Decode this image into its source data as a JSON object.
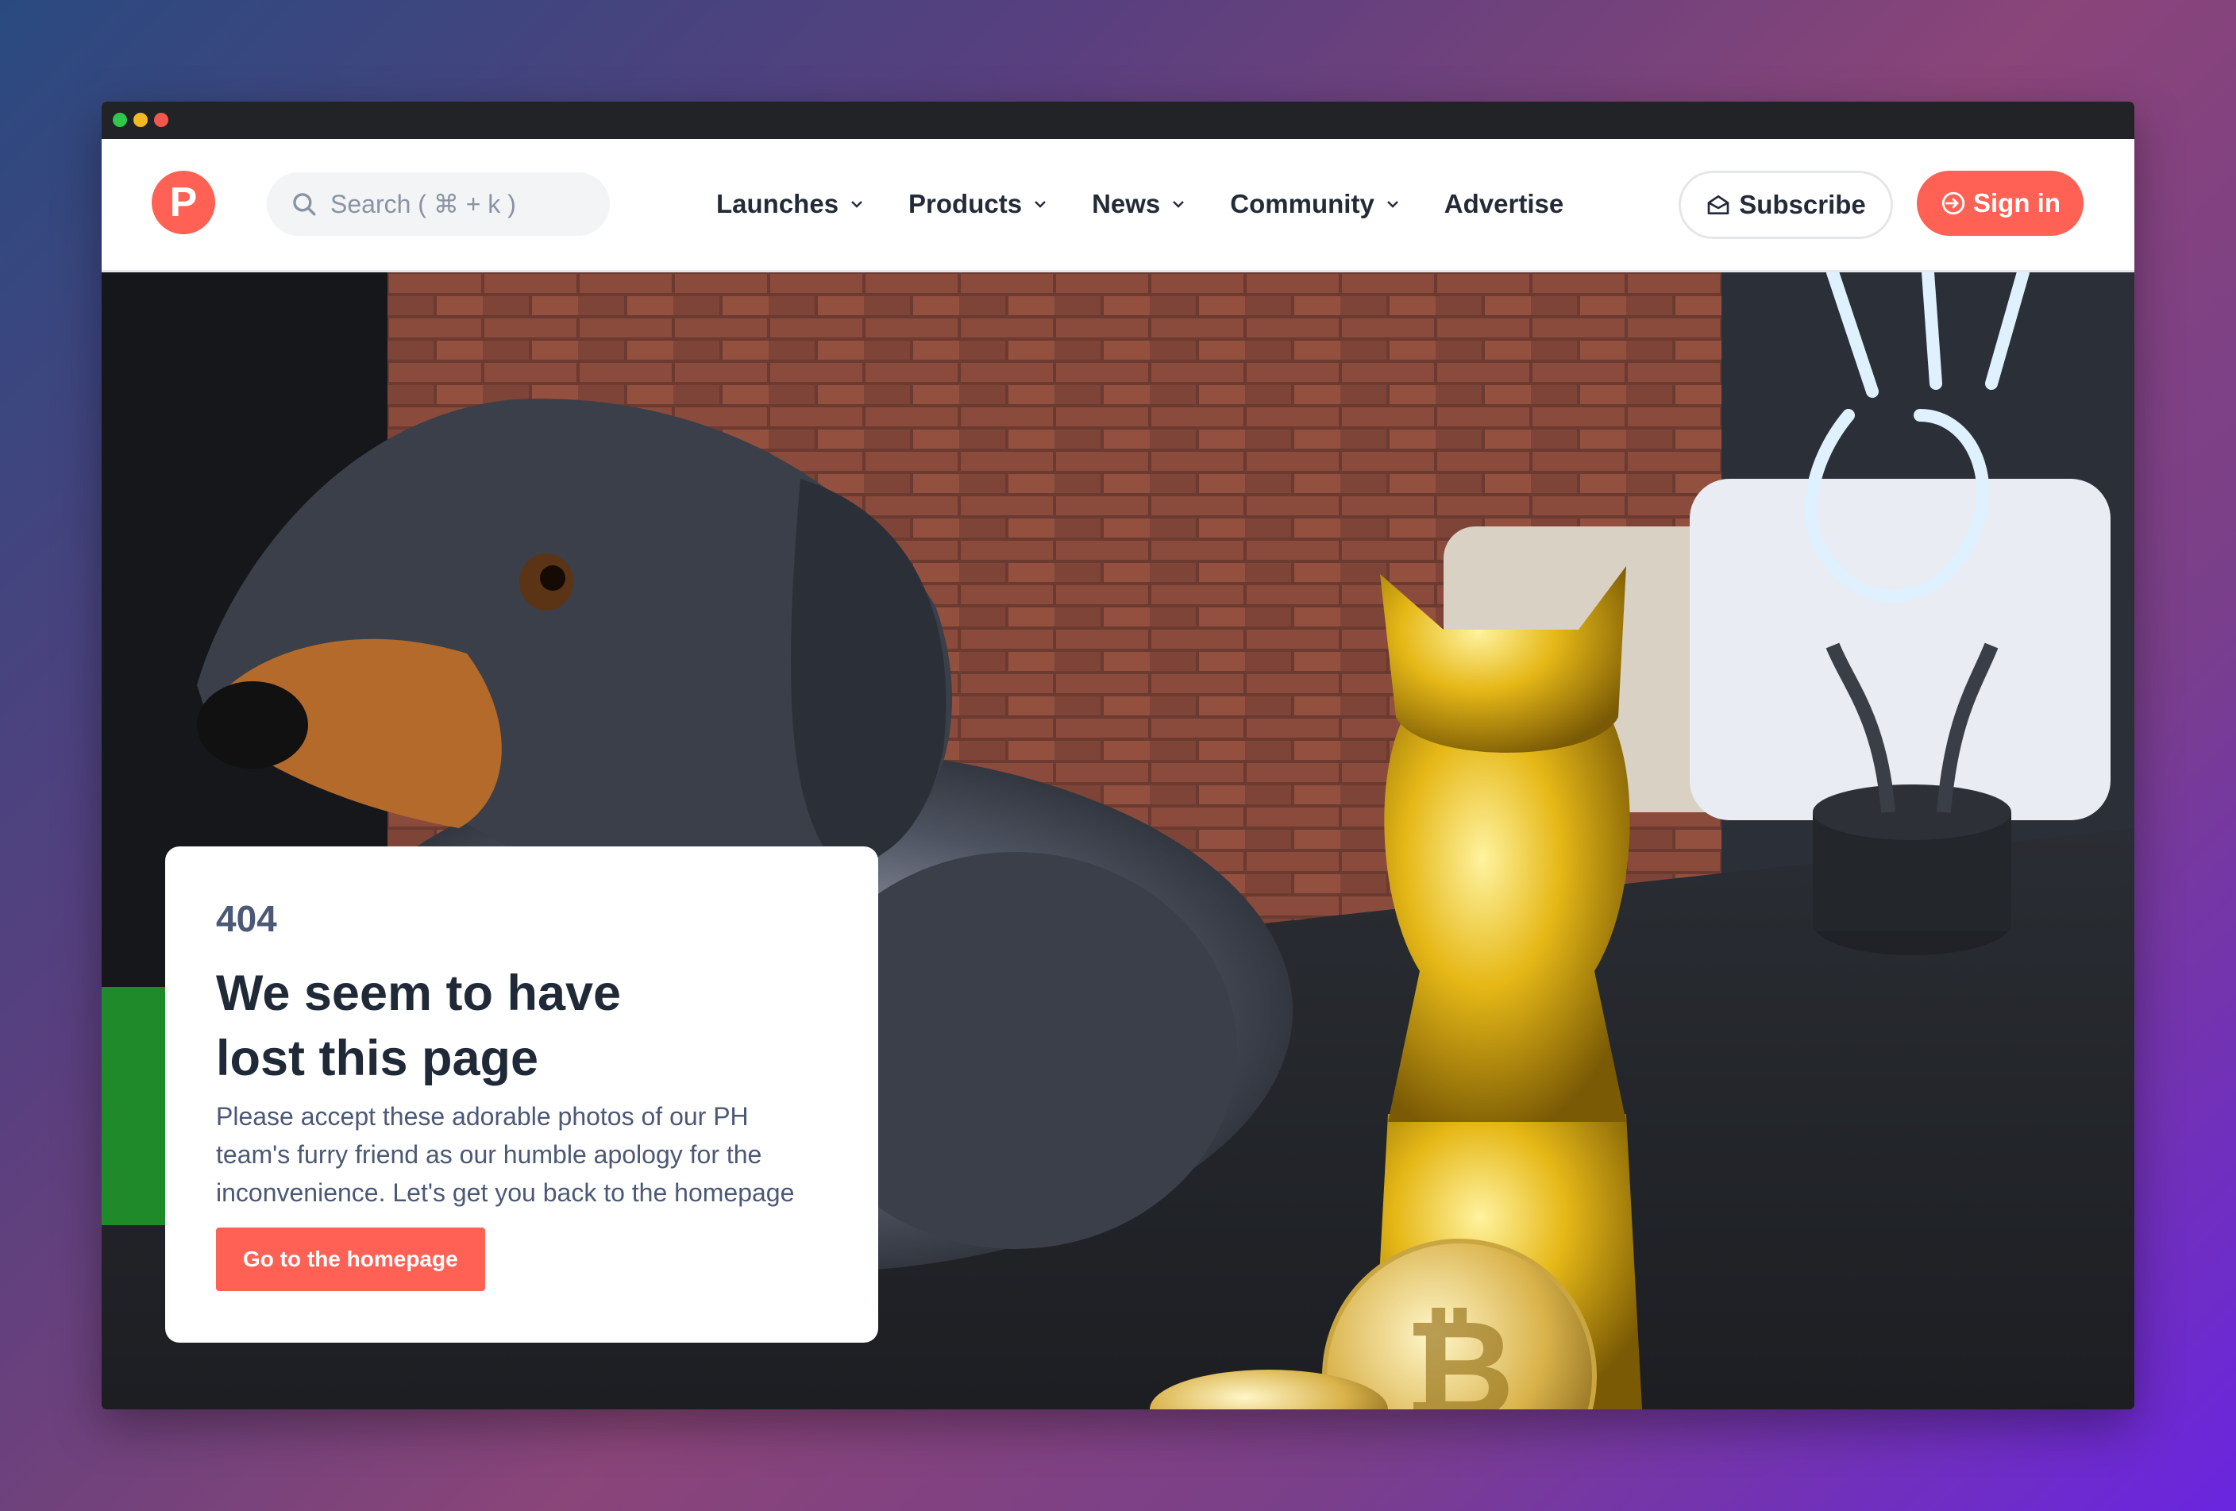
{
  "browser": {
    "traffic_lights": [
      "close",
      "minimize",
      "zoom"
    ]
  },
  "header": {
    "logo_letter": "P",
    "search_placeholder": "Search ( ⌘ + k )",
    "nav": [
      {
        "label": "Launches",
        "has_dropdown": true
      },
      {
        "label": "Products",
        "has_dropdown": true
      },
      {
        "label": "News",
        "has_dropdown": true
      },
      {
        "label": "Community",
        "has_dropdown": true
      },
      {
        "label": "Advertise",
        "has_dropdown": false
      }
    ],
    "subscribe_label": "Subscribe",
    "signin_label": "Sign in"
  },
  "error_card": {
    "code": "404",
    "title": "We seem to have lost this page",
    "description": "Please accept these adorable photos of our PH team's furry friend as our humble apology for the inconvenience. Let's get you back to the homepage",
    "cta_label": "Go to the homepage"
  },
  "colors": {
    "brand": "#ff6154",
    "text_dark": "#1f2937",
    "text_muted": "#4b5876"
  },
  "icons": [
    "search-icon",
    "envelope-icon",
    "sign-in-icon",
    "chevron-down-icon",
    "search-fab-icon"
  ]
}
